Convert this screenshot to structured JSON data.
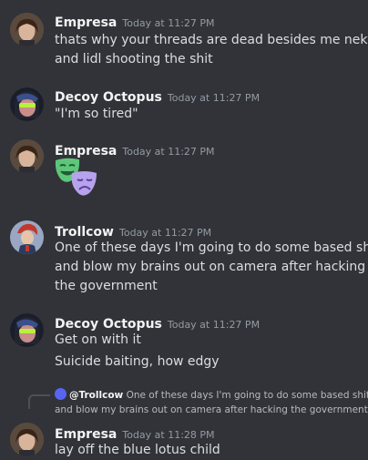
{
  "messages": [
    {
      "author": "Empresa",
      "timestamp": "Today at 11:27 PM",
      "lines": [
        "thats why your threads are dead besides me nektur",
        "and lidl shooting the shit"
      ]
    },
    {
      "author": "Decoy Octopus",
      "timestamp": "Today at 11:27 PM",
      "lines": [
        "\"I'm so tired\""
      ]
    },
    {
      "author": "Empresa",
      "timestamp": "Today at 11:27 PM",
      "emoji": "theater-masks"
    },
    {
      "author": "Trollcow",
      "timestamp": "Today at 11:27 PM",
      "lines": [
        "One of these days I'm going to do some based shit",
        "and blow my brains out on camera after hacking",
        "the government"
      ]
    },
    {
      "author": "Decoy Octopus",
      "timestamp": "Today at 11:27 PM",
      "lines": [
        "Get on with it"
      ],
      "followup": "Suicide baiting, how edgy"
    },
    {
      "author": "Empresa",
      "timestamp": "Today at 11:28 PM",
      "reply": {
        "mention": "@Trollcow",
        "line1": "One of these days I'm going to do some based shit",
        "line2": "and blow my brains out on camera after hacking the government"
      },
      "lines": [
        "lay off the blue lotus child"
      ]
    }
  ]
}
